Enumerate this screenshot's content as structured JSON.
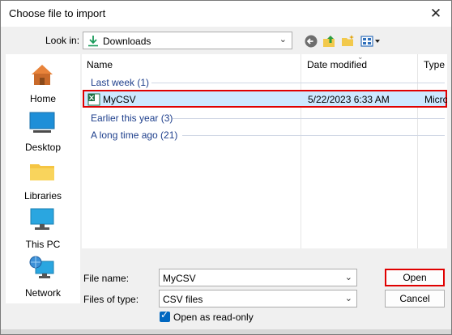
{
  "window": {
    "title": "Choose file to import"
  },
  "toolbar": {
    "look_in_label": "Look in:",
    "look_in_value": "Downloads",
    "icons": [
      "back-icon",
      "up-folder-icon",
      "new-folder-icon",
      "view-menu-icon"
    ]
  },
  "places": [
    {
      "label": "Home",
      "icon": "home-icon"
    },
    {
      "label": "Desktop",
      "icon": "desktop-icon"
    },
    {
      "label": "Libraries",
      "icon": "libraries-icon"
    },
    {
      "label": "This PC",
      "icon": "this-pc-icon"
    },
    {
      "label": "Network",
      "icon": "network-icon"
    }
  ],
  "file_list": {
    "columns": [
      "Name",
      "Date modified",
      "Type"
    ],
    "groups": [
      {
        "label": "Last week (1)"
      },
      {
        "label": "Earlier this year (3)"
      },
      {
        "label": "A long time ago (21)"
      }
    ],
    "selected_file": {
      "name": "MyCSV",
      "date": "5/22/2023 6:33 AM",
      "type": "Microsoft Excel Comma Separated Values File"
    }
  },
  "form": {
    "file_name_label": "File name:",
    "file_name_value": "MyCSV",
    "file_type_label": "Files of type:",
    "file_type_value": "CSV files",
    "readonly_label": "Open as read-only",
    "readonly_checked": true
  },
  "buttons": {
    "open": "Open",
    "cancel": "Cancel"
  },
  "colors": {
    "selection": "#cde8ff",
    "highlight": "#e00000",
    "group_text": "#1e3f8c",
    "accent": "#0067c0"
  }
}
